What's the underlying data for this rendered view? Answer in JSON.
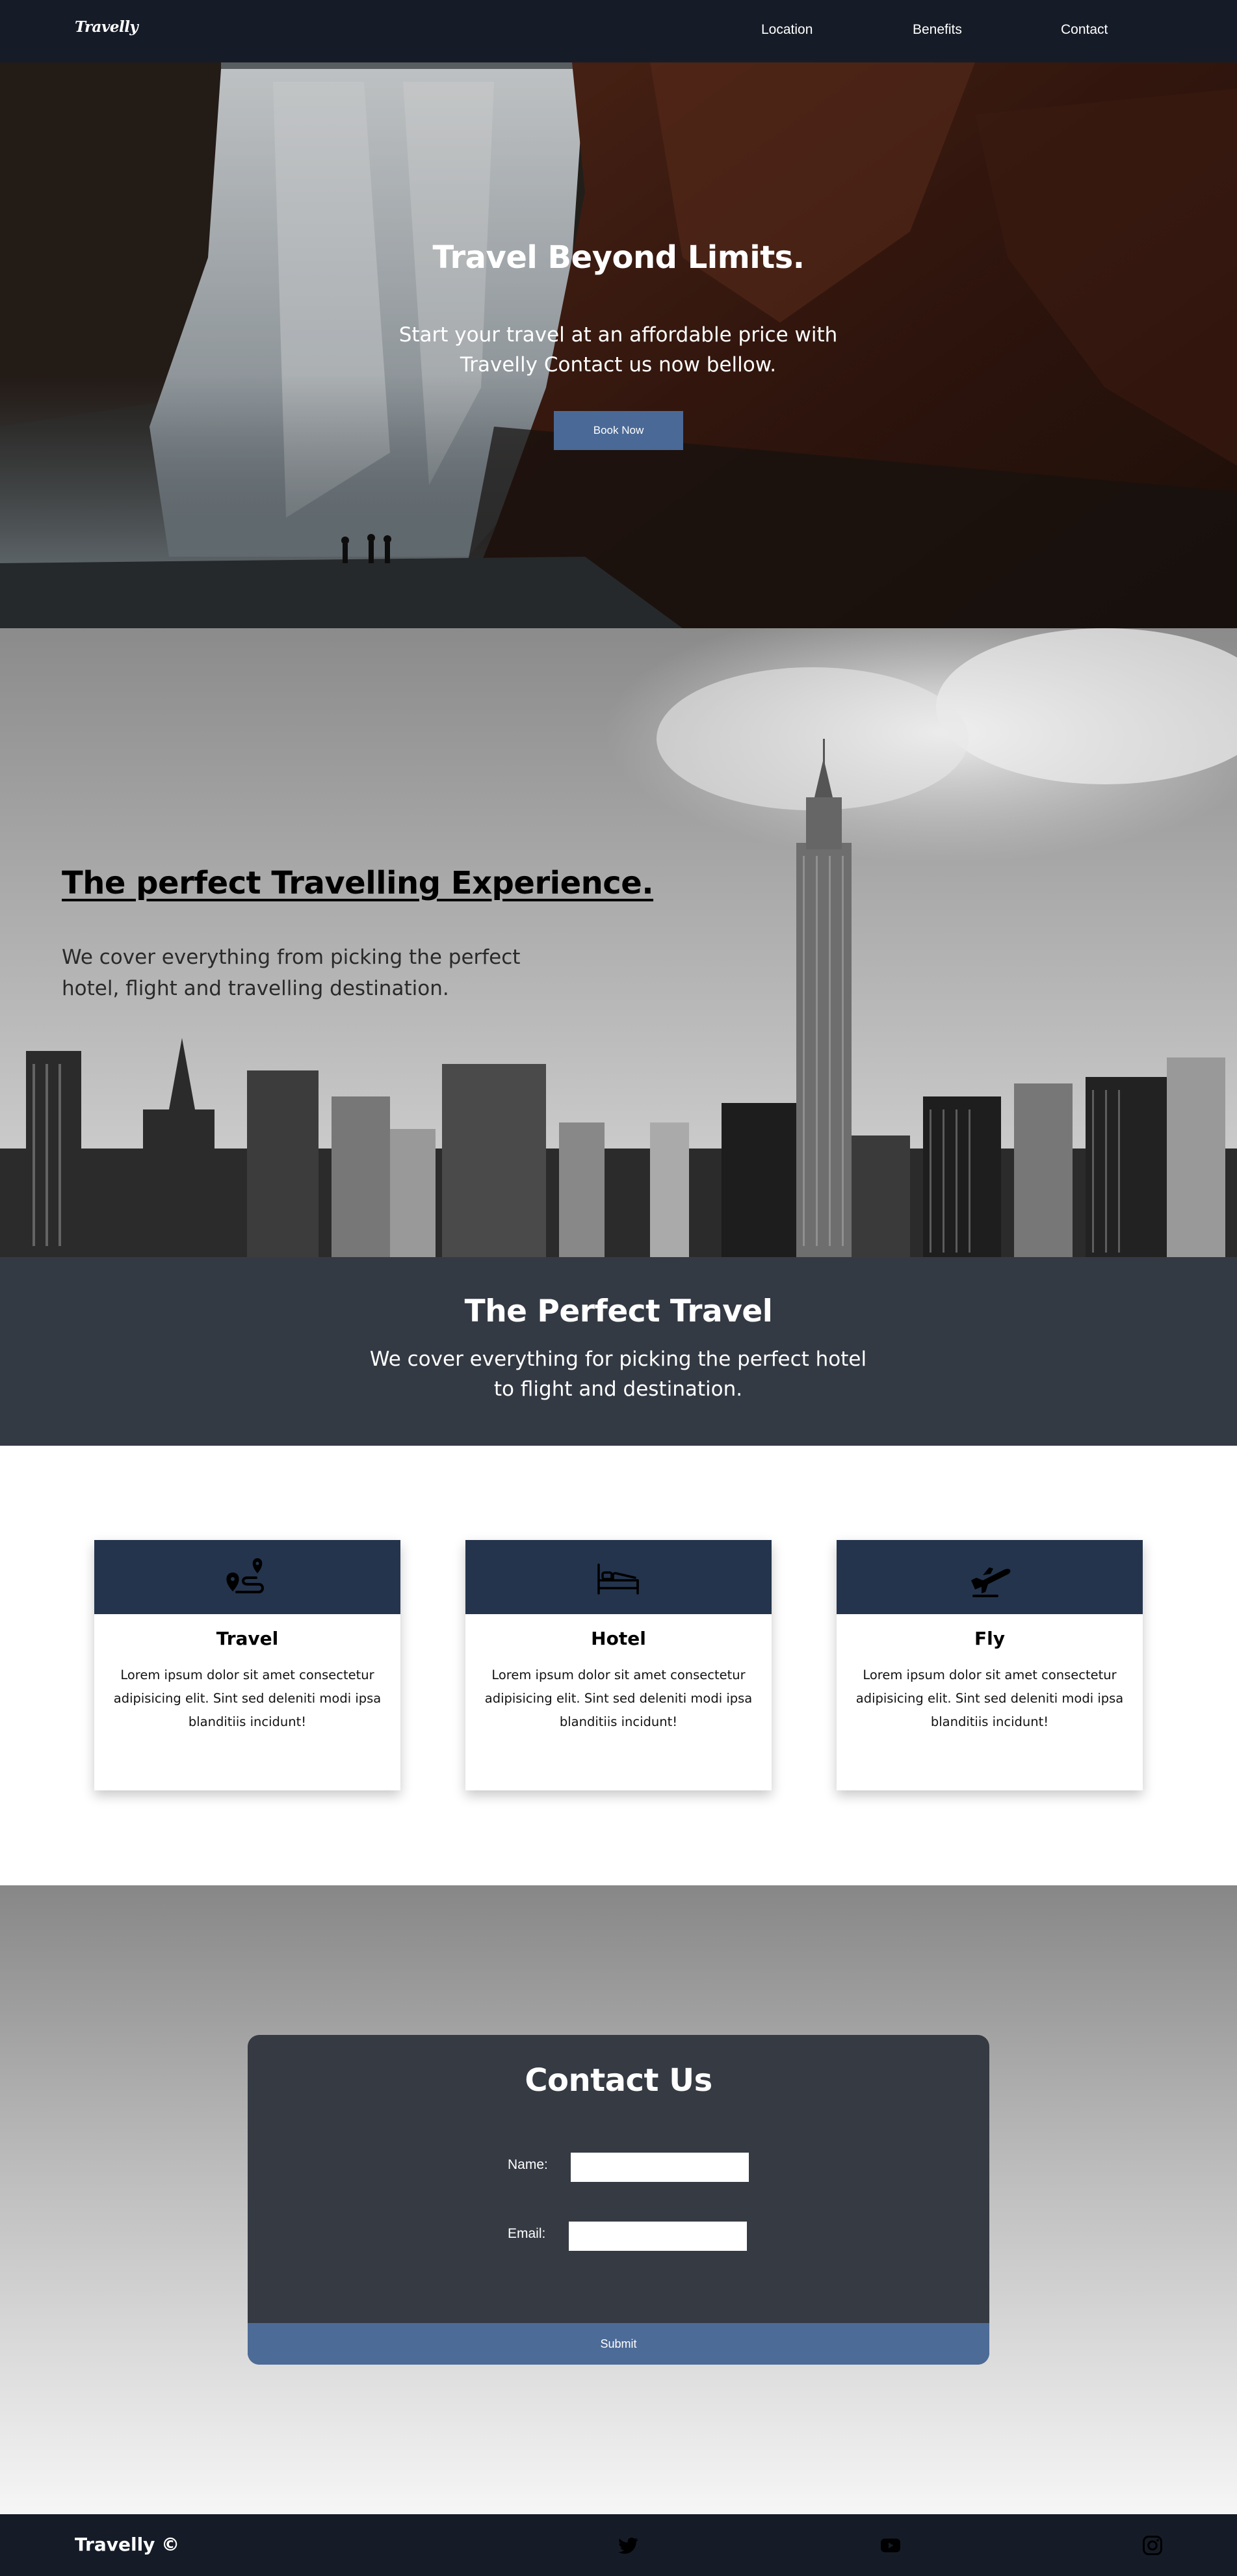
{
  "nav": {
    "logo": "Travelly",
    "links": [
      "Location",
      "Benefits",
      "Contact"
    ]
  },
  "hero": {
    "title": "Travel Beyond Limits.",
    "subtitle": "Start your travel at an affordable price with Travelly Contact us now bellow.",
    "button": "Book Now",
    "button_color": "#4a6996"
  },
  "experience": {
    "title": "The perfect Travelling Experience.",
    "text": "We cover everything from picking the perfect hotel, flight and travelling destination."
  },
  "band": {
    "title": "The Perfect Travel",
    "text": "We cover everything for picking the perfect hotel to flight and destination."
  },
  "features": [
    {
      "icon": "map-route-icon",
      "title": "Travel",
      "text": "Lorem ipsum dolor sit amet consectetur adipisicing elit. Sint sed deleniti modi ipsa blanditiis incidunt!"
    },
    {
      "icon": "bed-icon",
      "title": "Hotel",
      "text": "Lorem ipsum dolor sit amet consectetur adipisicing elit. Sint sed deleniti modi ipsa blanditiis incidunt!"
    },
    {
      "icon": "airplane-icon",
      "title": "Fly",
      "text": "Lorem ipsum dolor sit amet consectetur adipisicing elit. Sint sed deleniti modi ipsa blanditiis incidunt!"
    }
  ],
  "contact": {
    "title": "Contact Us",
    "name_label": "Name:",
    "email_label": "Email:",
    "submit": "Submit"
  },
  "footer": {
    "brand": "Travelly ©",
    "social": [
      "twitter-icon",
      "youtube-icon",
      "instagram-icon"
    ]
  },
  "colors": {
    "nav_bg": "#161c27",
    "band_bg": "#343a44",
    "card_head": "#24344d",
    "form_bg": "#353a43",
    "accent": "#4d6b97"
  }
}
